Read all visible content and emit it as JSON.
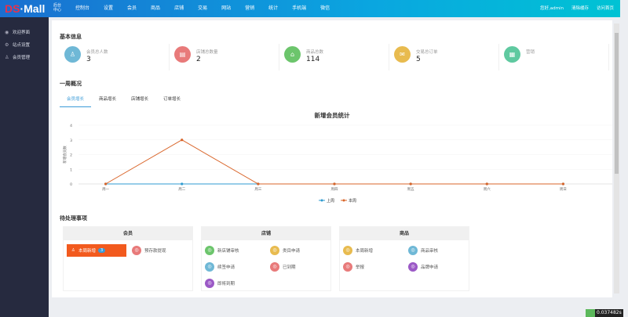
{
  "header": {
    "logo": "DS·Mall",
    "logo_ds": "DS",
    "logo_mall": "·Mall",
    "logo_sub": "后台中心",
    "nav": [
      "控制台",
      "设置",
      "会员",
      "商品",
      "店铺",
      "交易",
      "网站",
      "营销",
      "统计",
      "手机端",
      "微信"
    ],
    "greeting": "您好,admin",
    "clear_cache": "清除缓存",
    "visit_home": "访问首页"
  },
  "sidebar": {
    "items": [
      {
        "label": "欢迎界面",
        "icon": "eye-icon"
      },
      {
        "label": "站点设置",
        "icon": "gear-icon"
      },
      {
        "label": "会员管理",
        "icon": "user-icon"
      }
    ]
  },
  "basic": {
    "title": "基本信息",
    "cards": [
      {
        "label": "会员总人数",
        "value": "3",
        "color": "#6fb8d6",
        "icon": "user-icon"
      },
      {
        "label": "店铺总数量",
        "value": "2",
        "color": "#e87a7a",
        "icon": "store-icon"
      },
      {
        "label": "商品总数",
        "value": "114",
        "color": "#6cc56c",
        "icon": "bag-icon"
      },
      {
        "label": "交易总订单",
        "value": "5",
        "color": "#e8bb4f",
        "icon": "order-icon"
      },
      {
        "label": "营销",
        "value": "",
        "color": "#5fc9a0",
        "icon": "gift-icon"
      }
    ]
  },
  "week": {
    "title": "一周概况",
    "tabs": [
      "会员增长",
      "商品增长",
      "店铺增长",
      "订单增长"
    ],
    "active_tab": 0
  },
  "chart_data": {
    "type": "line",
    "title": "新增会员统计",
    "ylabel": "新增会员数",
    "categories": [
      "周一",
      "周二",
      "周三",
      "周四",
      "周五",
      "周六",
      "周日"
    ],
    "ylim": [
      0,
      4
    ],
    "yticks": [
      0,
      1,
      2,
      3,
      4
    ],
    "grid": true,
    "legend": "bottom",
    "series": [
      {
        "name": "上周",
        "color": "#2f9bd0",
        "values": [
          0,
          0,
          0,
          0,
          0,
          0,
          0
        ]
      },
      {
        "name": "本周",
        "color": "#d9652a",
        "values": [
          0,
          3,
          0,
          0,
          0,
          0,
          0
        ]
      }
    ]
  },
  "pending": {
    "title": "待处理事项",
    "groups": [
      {
        "title": "会员",
        "items": [
          {
            "label": "本周新增",
            "badge": "3",
            "highlight": true
          },
          {
            "label": "预存款提现",
            "color": "#e87a7a"
          }
        ]
      },
      {
        "title": "店铺",
        "items": [
          {
            "label": "新店铺审核",
            "color": "#6cc56c"
          },
          {
            "label": "类目申请",
            "color": "#e8bb4f"
          },
          {
            "label": "续签申请",
            "color": "#6fb8d6"
          },
          {
            "label": "已到期",
            "color": "#e87a7a"
          },
          {
            "label": "即将到期",
            "color": "#9b59c6"
          }
        ]
      },
      {
        "title": "商品",
        "items": [
          {
            "label": "本周新增",
            "color": "#e8bb4f"
          },
          {
            "label": "商品审核",
            "color": "#6fb8d6"
          },
          {
            "label": "举报",
            "color": "#e87a7a"
          },
          {
            "label": "品牌申请",
            "color": "#9b59c6"
          }
        ]
      }
    ]
  },
  "timer": "0.037482s"
}
